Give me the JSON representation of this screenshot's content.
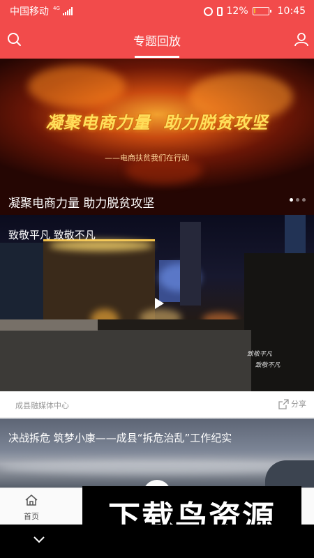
{
  "status_bar": {
    "carrier": "中国移动",
    "network": "4G",
    "battery": "12%",
    "battery_level": 0.12,
    "time": "10:45",
    "battery_fill_color": "#f0b428"
  },
  "header": {
    "title": "专题回放",
    "bg_color": "#f24b4b",
    "search_icon": "search-icon",
    "user_icon": "user-icon"
  },
  "banner": {
    "slogan": "凝聚电商力量  助力脱贫攻坚",
    "subtitle": "——电商扶贫我们在行动",
    "title": "凝聚电商力量 助力脱贫攻坚",
    "slides": 3,
    "active_slide": 1
  },
  "video_card": {
    "title": "致敬平凡 致敬不凡",
    "watermark": "致敬平凡\n    致敬不凡",
    "source": "成县融媒体中心",
    "share_label": "分享",
    "play_icon": "play-icon",
    "share_icon": "share-icon"
  },
  "card2": {
    "title": "决战拆危 筑梦小康——成县“拆危治乱”工作纪实"
  },
  "tabbar": {
    "home_label": "首页",
    "home_icon": "home-icon"
  },
  "overlay": {
    "text": "下载鸟资源"
  },
  "system_nav": {
    "icon": "chevron-down-icon"
  }
}
